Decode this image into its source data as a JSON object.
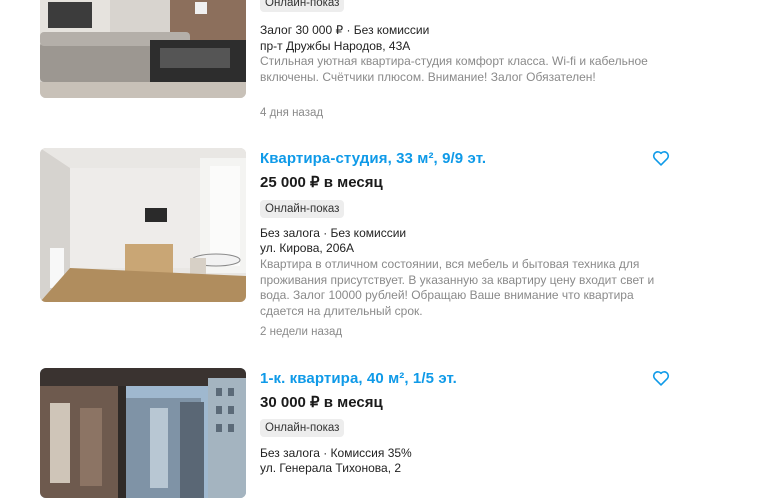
{
  "listings": [
    {
      "badge": "Онлайн-показ",
      "terms": "Залог 30 000 ₽ · Без комиссии",
      "address": "пр-т Дружбы Народов, 43А",
      "description": "Стильная уютная квартира-студия комфорт класса. Wi-fi и кабельное включены. Счётчики плюсом. Внимание! Залог Обязателен!",
      "age": "4 дня назад"
    },
    {
      "title": "Квартира-студия, 33 м², 9/9 эт.",
      "price": "25 000 ₽ в месяц",
      "badge": "Онлайн-показ",
      "terms": "Без залога · Без комиссии",
      "address": "ул. Кирова, 206А",
      "description": "Квартира в отличном состоянии, вся мебель и бытовая техника для проживания присутствует. В указанную за квартиру цену входит свет и вода. Залог 10000 рублей! Обращаю Ваше внимание что квартира сдается на длительный срок.",
      "age": "2 недели назад",
      "favorite_icon": "heart-outline-icon"
    },
    {
      "title": "1-к. квартира, 40 м², 1/5 эт.",
      "price": "30 000 ₽ в месяц",
      "badge": "Онлайн-показ",
      "terms": "Без залога · Комиссия 35%",
      "address": "ул. Генерала Тихонова, 2",
      "favorite_icon": "heart-outline-icon"
    }
  ],
  "colors": {
    "accent": "#0f9ae8",
    "muted": "#8a8a8a",
    "badge_bg": "#ededed"
  }
}
